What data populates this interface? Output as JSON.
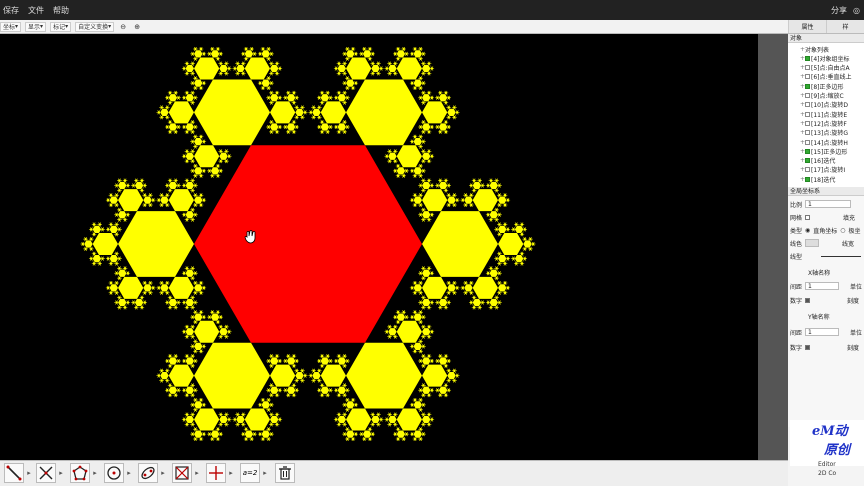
{
  "menubar": {
    "items": [
      "保存",
      "文件",
      "帮助"
    ],
    "share": "分享",
    "right_extra": "◎"
  },
  "toolbar": {
    "items": [
      "坐标",
      "显示",
      "标记",
      "自定义变换"
    ],
    "zoom_in": "⊕",
    "zoom_out": "⊖"
  },
  "side": {
    "tab_1": "属性",
    "tab_2": "样",
    "objects_title": "对象",
    "objects": [
      {
        "label": "对象列表",
        "checked": true,
        "has_checkbox": false
      },
      {
        "label": "[4]对象组坐标",
        "checked": true,
        "has_checkbox": true
      },
      {
        "label": "[5]点:自由点A",
        "checked": false,
        "has_checkbox": true
      },
      {
        "label": "[6]点:垂直线上",
        "checked": false,
        "has_checkbox": true
      },
      {
        "label": "[8]正多边形",
        "checked": true,
        "has_checkbox": true
      },
      {
        "label": "[9]点:缩放C",
        "checked": false,
        "has_checkbox": true
      },
      {
        "label": "[10]点:旋转D",
        "checked": false,
        "has_checkbox": true
      },
      {
        "label": "[11]点:旋转E",
        "checked": false,
        "has_checkbox": true
      },
      {
        "label": "[12]点:旋转F",
        "checked": false,
        "has_checkbox": true
      },
      {
        "label": "[13]点:旋转G",
        "checked": false,
        "has_checkbox": true
      },
      {
        "label": "[14]点:旋转H",
        "checked": false,
        "has_checkbox": true
      },
      {
        "label": "[15]正多边形",
        "checked": true,
        "has_checkbox": true
      },
      {
        "label": "[16]迭代",
        "checked": true,
        "has_checkbox": true
      },
      {
        "label": "[17]点:旋转I",
        "checked": false,
        "has_checkbox": true
      },
      {
        "label": "[18]迭代",
        "checked": true,
        "has_checkbox": true
      }
    ],
    "props_title": "全局坐标系",
    "scale_label": "比例",
    "scale_value": "1",
    "grid_label": "网格",
    "fill_label": "填充",
    "type_label": "类型",
    "type_opt1": "直角坐标",
    "type_opt2": "极坐",
    "color_label": "线色",
    "width_label": "线宽",
    "style_label": "线型",
    "x_axis_title": "X轴名称",
    "x_period_label": "间距",
    "x_period_value": "1",
    "x_unit_label": "单位",
    "x_number_label": "数字",
    "x_tick_label": "刻度",
    "y_axis_title": "Y轴名称",
    "y_period_label": "间距",
    "y_period_value": "1",
    "y_unit_label": "单位",
    "y_number_label": "数字",
    "y_tick_label": "刻度"
  },
  "logo": {
    "line1": "eM动",
    "line2": "原创"
  },
  "footer": {
    "line1": "Editor",
    "line2": "2D Co"
  },
  "bottom_tools": [
    "segment-tool",
    "line-tool",
    "polygon-tool",
    "circle-tool",
    "conic-tool",
    "transform-tool",
    "point-tool",
    "text-tool",
    "delete-tool"
  ],
  "bottom_text_tool_label": "a=2",
  "colors": {
    "center_hex": "#ff0000",
    "fractal": "#ffff00",
    "background": "#000000"
  }
}
